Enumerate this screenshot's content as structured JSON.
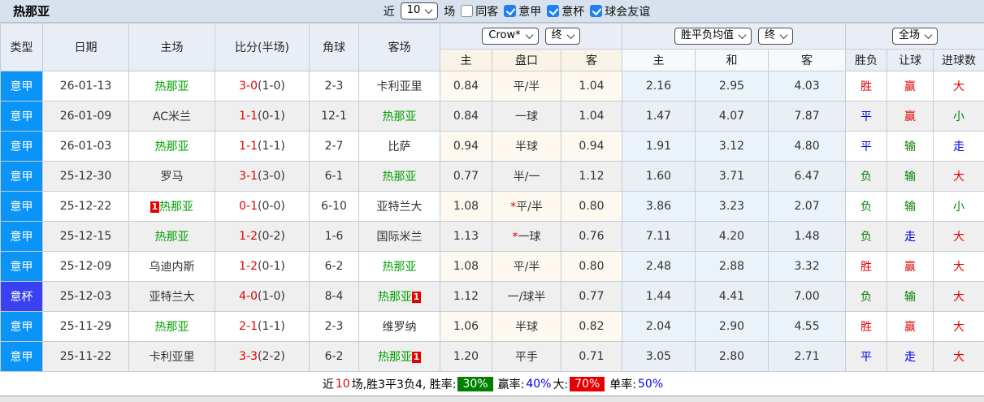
{
  "colors": {
    "red": "#e60000",
    "green": "#008000",
    "blue": "#0000ee",
    "teamgreen": "#00a000",
    "checkblue": "#2080f0",
    "leaguebg": "#0b94f8",
    "cupbg": "#3a41f0",
    "badgegreen": "#008000",
    "badgered": "#e60000"
  },
  "title": "热那亚",
  "filter": {
    "recent_label": "近",
    "recent_value": "10",
    "matches_label": "场",
    "checkboxes": [
      {
        "label": "同客",
        "checked": false
      },
      {
        "label": "意甲",
        "checked": true
      },
      {
        "label": "意杯",
        "checked": true
      },
      {
        "label": "球会友谊",
        "checked": true
      }
    ]
  },
  "table": {
    "static_headers": [
      "类型",
      "日期",
      "主场",
      "比分(半场)",
      "角球",
      "客场"
    ],
    "groups": [
      {
        "selects": [
          {
            "name": "bookmaker-select",
            "value": "Crow*"
          },
          {
            "name": "odds-stage-select",
            "value": "终"
          }
        ],
        "sub": [
          "主",
          "盘口",
          "客"
        ]
      },
      {
        "selects": [
          {
            "name": "avg-metric-select",
            "value": "胜平负均值"
          },
          {
            "name": "avg-stage-select",
            "value": "终"
          }
        ],
        "sub": [
          "主",
          "和",
          "客"
        ]
      },
      {
        "selects": [
          {
            "name": "scope-select",
            "value": "全场"
          }
        ],
        "sub": [
          "胜负",
          "让球",
          "进球数"
        ]
      }
    ],
    "type_styles": {
      "意甲": "leaguebg",
      "意杯": "cupbg"
    },
    "rows": [
      {
        "type": "意甲",
        "date": "26-01-13",
        "home": {
          "name": "热那亚",
          "green": true
        },
        "score": "3-0",
        "half": "(1-0)",
        "corners": "2-3",
        "away": {
          "name": "卡利亚里",
          "green": false
        },
        "odds": {
          "home": "0.84",
          "star": "",
          "handicap": "平/半",
          "away": "1.04"
        },
        "avg": {
          "home": "2.16",
          "draw": "2.95",
          "away": "4.03"
        },
        "results": [
          {
            "text": "胜",
            "color": "red"
          },
          {
            "text": "赢",
            "color": "red"
          },
          {
            "text": "大",
            "color": "red"
          }
        ]
      },
      {
        "type": "意甲",
        "date": "26-01-09",
        "home": {
          "name": "AC米兰",
          "green": false
        },
        "score": "1-1",
        "half": "(0-1)",
        "corners": "12-1",
        "away": {
          "name": "热那亚",
          "green": true
        },
        "odds": {
          "home": "0.84",
          "star": "",
          "handicap": "一球",
          "away": "1.04"
        },
        "avg": {
          "home": "1.47",
          "draw": "4.07",
          "away": "7.87"
        },
        "results": [
          {
            "text": "平",
            "color": "blue"
          },
          {
            "text": "赢",
            "color": "red"
          },
          {
            "text": "小",
            "color": "green"
          }
        ]
      },
      {
        "type": "意甲",
        "date": "26-01-03",
        "home": {
          "name": "热那亚",
          "green": true
        },
        "score": "1-1",
        "half": "(1-1)",
        "corners": "2-7",
        "away": {
          "name": "比萨",
          "green": false
        },
        "odds": {
          "home": "0.94",
          "star": "",
          "handicap": "半球",
          "away": "0.94"
        },
        "avg": {
          "home": "1.91",
          "draw": "3.12",
          "away": "4.80"
        },
        "results": [
          {
            "text": "平",
            "color": "blue"
          },
          {
            "text": "输",
            "color": "green"
          },
          {
            "text": "走",
            "color": "blue"
          }
        ]
      },
      {
        "type": "意甲",
        "date": "25-12-30",
        "home": {
          "name": "罗马",
          "green": false
        },
        "score": "3-1",
        "half": "(3-0)",
        "corners": "6-1",
        "away": {
          "name": "热那亚",
          "green": true
        },
        "odds": {
          "home": "0.77",
          "star": "",
          "handicap": "半/一",
          "away": "1.12"
        },
        "avg": {
          "home": "1.60",
          "draw": "3.71",
          "away": "6.47"
        },
        "results": [
          {
            "text": "负",
            "color": "green"
          },
          {
            "text": "输",
            "color": "green"
          },
          {
            "text": "大",
            "color": "red"
          }
        ]
      },
      {
        "type": "意甲",
        "date": "25-12-22",
        "home": {
          "name": "热那亚",
          "green": true,
          "card": "1",
          "card_side": "left"
        },
        "score": "0-1",
        "half": "(0-0)",
        "corners": "6-10",
        "away": {
          "name": "亚特兰大",
          "green": false
        },
        "odds": {
          "home": "1.08",
          "star": "*",
          "handicap": "平/半",
          "away": "0.80"
        },
        "avg": {
          "home": "3.86",
          "draw": "3.23",
          "away": "2.07"
        },
        "results": [
          {
            "text": "负",
            "color": "green"
          },
          {
            "text": "输",
            "color": "green"
          },
          {
            "text": "小",
            "color": "green"
          }
        ]
      },
      {
        "type": "意甲",
        "date": "25-12-15",
        "home": {
          "name": "热那亚",
          "green": true
        },
        "score": "1-2",
        "half": "(0-2)",
        "corners": "1-6",
        "away": {
          "name": "国际米兰",
          "green": false
        },
        "odds": {
          "home": "1.13",
          "star": "*",
          "handicap": "一球",
          "away": "0.76"
        },
        "avg": {
          "home": "7.11",
          "draw": "4.20",
          "away": "1.48"
        },
        "results": [
          {
            "text": "负",
            "color": "green"
          },
          {
            "text": "走",
            "color": "blue"
          },
          {
            "text": "大",
            "color": "red"
          }
        ]
      },
      {
        "type": "意甲",
        "date": "25-12-09",
        "home": {
          "name": "乌迪内斯",
          "green": false
        },
        "score": "1-2",
        "half": "(0-1)",
        "corners": "6-2",
        "away": {
          "name": "热那亚",
          "green": true
        },
        "odds": {
          "home": "1.08",
          "star": "",
          "handicap": "平/半",
          "away": "0.80"
        },
        "avg": {
          "home": "2.48",
          "draw": "2.88",
          "away": "3.32"
        },
        "results": [
          {
            "text": "胜",
            "color": "red"
          },
          {
            "text": "赢",
            "color": "red"
          },
          {
            "text": "大",
            "color": "red"
          }
        ]
      },
      {
        "type": "意杯",
        "date": "25-12-03",
        "home": {
          "name": "亚特兰大",
          "green": false
        },
        "score": "4-0",
        "half": "(1-0)",
        "corners": "8-4",
        "away": {
          "name": "热那亚",
          "green": true,
          "card": "1",
          "card_side": "right"
        },
        "odds": {
          "home": "1.12",
          "star": "",
          "handicap": "一/球半",
          "away": "0.77"
        },
        "avg": {
          "home": "1.44",
          "draw": "4.41",
          "away": "7.00"
        },
        "results": [
          {
            "text": "负",
            "color": "green"
          },
          {
            "text": "输",
            "color": "green"
          },
          {
            "text": "大",
            "color": "red"
          }
        ]
      },
      {
        "type": "意甲",
        "date": "25-11-29",
        "home": {
          "name": "热那亚",
          "green": true
        },
        "score": "2-1",
        "half": "(1-1)",
        "corners": "2-3",
        "away": {
          "name": "维罗纳",
          "green": false
        },
        "odds": {
          "home": "1.06",
          "star": "",
          "handicap": "半球",
          "away": "0.82"
        },
        "avg": {
          "home": "2.04",
          "draw": "2.90",
          "away": "4.55"
        },
        "results": [
          {
            "text": "胜",
            "color": "red"
          },
          {
            "text": "赢",
            "color": "red"
          },
          {
            "text": "大",
            "color": "red"
          }
        ]
      },
      {
        "type": "意甲",
        "date": "25-11-22",
        "home": {
          "name": "卡利亚里",
          "green": false
        },
        "score": "3-3",
        "half": "(2-2)",
        "corners": "6-2",
        "away": {
          "name": "热那亚",
          "green": true,
          "card": "1",
          "card_side": "right"
        },
        "odds": {
          "home": "1.20",
          "star": "",
          "handicap": "平手",
          "away": "0.71"
        },
        "avg": {
          "home": "3.05",
          "draw": "2.80",
          "away": "2.71"
        },
        "results": [
          {
            "text": "平",
            "color": "blue"
          },
          {
            "text": "走",
            "color": "blue"
          },
          {
            "text": "大",
            "color": "red"
          }
        ]
      }
    ]
  },
  "summary": {
    "segments": [
      {
        "text": "近"
      },
      {
        "text": "10",
        "color": "red"
      },
      {
        "text": "场,胜3平3负4, 胜率:"
      },
      {
        "text": "30%",
        "badge": "green"
      },
      {
        "text": "赢率:"
      },
      {
        "text": "40%",
        "color": "blue"
      },
      {
        "text": "大:"
      },
      {
        "text": "70%",
        "badge": "red"
      },
      {
        "text": "单率:"
      },
      {
        "text": "50%",
        "color": "blue"
      }
    ]
  }
}
